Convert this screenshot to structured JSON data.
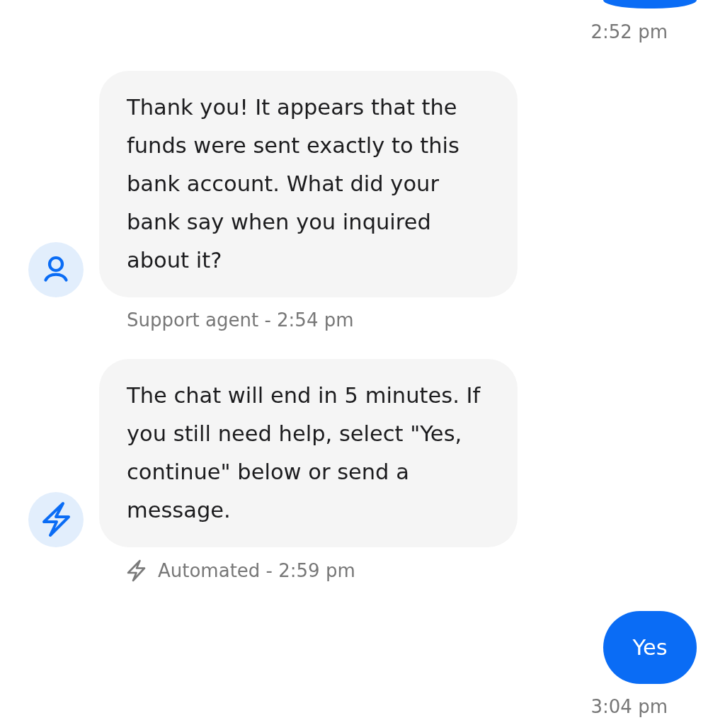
{
  "messages": [
    {
      "kind": "outgoing",
      "cut_off": true,
      "time": "2:52 pm"
    },
    {
      "kind": "agent",
      "text": "Thank you! It appears that the funds were sent exactly to this bank account. What did your bank say when you inquired about it?",
      "meta": "Support agent - 2:54 pm"
    },
    {
      "kind": "automated",
      "text": "The chat will end in 5 minutes. If you still need help, select \"Yes, continue\" below or send a message.",
      "meta": "Automated - 2:59 pm"
    },
    {
      "kind": "outgoing",
      "cut_off": false,
      "text": "Yes",
      "time": "3:04 pm"
    }
  ]
}
